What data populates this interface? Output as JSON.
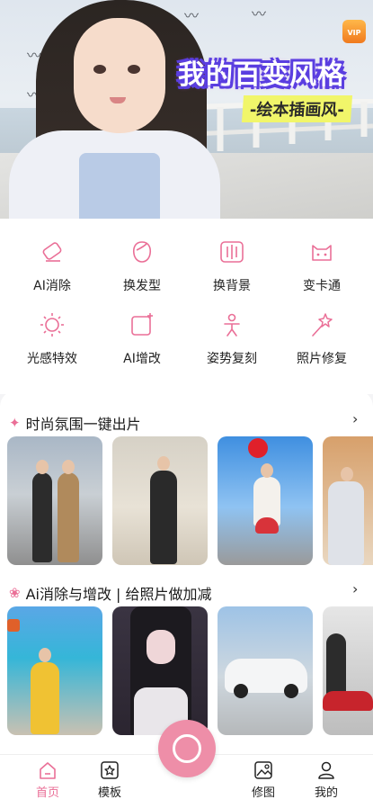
{
  "hero": {
    "title": "我的百变风格",
    "subtitle": "-绘本插画风-",
    "vip_badge": "VIP"
  },
  "tools": [
    {
      "label": "AI消除",
      "icon": "eraser-icon"
    },
    {
      "label": "换发型",
      "icon": "hairstyle-icon"
    },
    {
      "label": "换背景",
      "icon": "background-icon"
    },
    {
      "label": "变卡通",
      "icon": "cartoon-cat-icon"
    },
    {
      "label": "光感特效",
      "icon": "sun-icon"
    },
    {
      "label": "AI增改",
      "icon": "ai-edit-icon"
    },
    {
      "label": "姿势复刻",
      "icon": "pose-icon"
    },
    {
      "label": "照片修复",
      "icon": "magic-wand-icon"
    }
  ],
  "sections": [
    {
      "title": "时尚氛围一键出片",
      "icon": "sparkle-icon",
      "arrow": "›"
    },
    {
      "title": "Ai消除与增改 | 给照片做加减",
      "icon": "flower-icon",
      "arrow": "›"
    }
  ],
  "tabbar": {
    "home": "首页",
    "template": "模板",
    "edit": "修图",
    "mine": "我的"
  },
  "colors": {
    "accent": "#ea6f97",
    "center_button": "#ee8ea8",
    "title_outline": "#5a3ee0",
    "subtitle_bg": "#f1f66a"
  }
}
